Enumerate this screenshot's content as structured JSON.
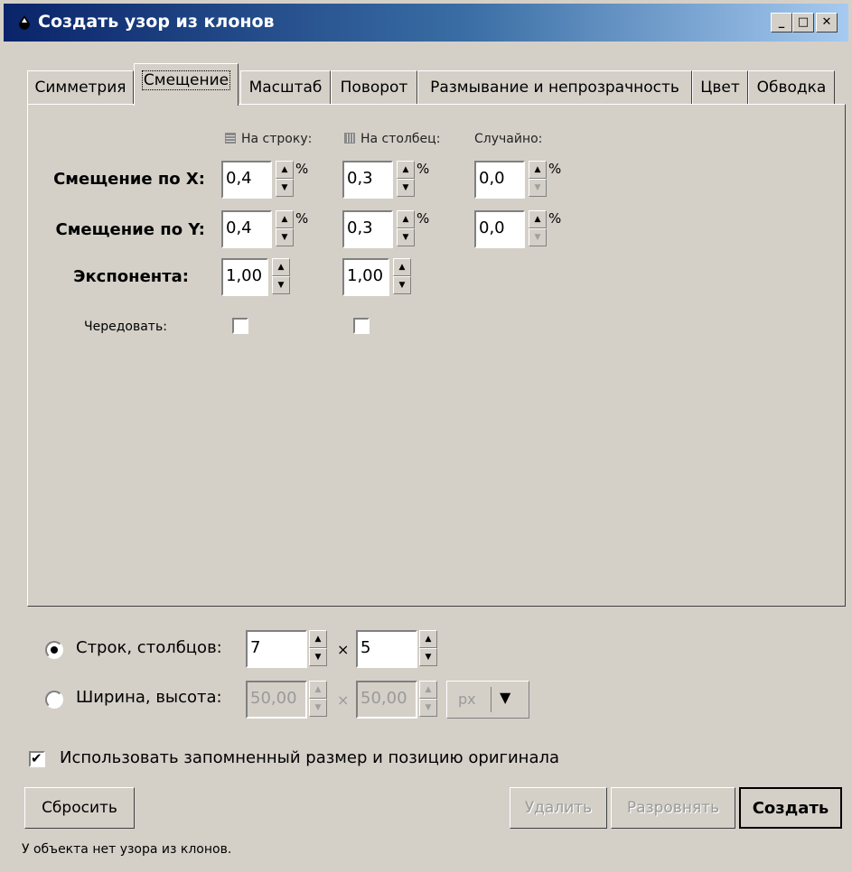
{
  "window": {
    "title": "Создать узор из клонов",
    "controls": {
      "minimize": "_",
      "maximize": "□",
      "close": "✕"
    }
  },
  "tabs": [
    {
      "label": "Симметрия"
    },
    {
      "label": "Смещение",
      "active": true
    },
    {
      "label": "Масштаб"
    },
    {
      "label": "Поворот"
    },
    {
      "label": "Размывание и непрозрачность"
    },
    {
      "label": "Цвет"
    },
    {
      "label": "Обводка"
    }
  ],
  "shift_tab": {
    "columns": {
      "per_row": "На строку:",
      "per_column": "На столбец:",
      "random": "Случайно:"
    },
    "shift_x": {
      "label": "Смещение по X:",
      "per_row": "0,4",
      "per_column": "0,3",
      "random": "0,0",
      "unit": "%"
    },
    "shift_y": {
      "label": "Смещение по Y:",
      "per_row": "0,4",
      "per_column": "0,3",
      "random": "0,0",
      "unit": "%"
    },
    "exponent": {
      "label": "Экспонента:",
      "per_row": "1,00",
      "per_column": "1,00"
    },
    "alternate": {
      "label": "Чередовать:",
      "per_row": false,
      "per_column": false
    }
  },
  "size_mode": {
    "rows_cols": {
      "label": "Строк, столбцов:",
      "rows": "7",
      "cols": "5",
      "selected": true
    },
    "width_height": {
      "label": "Ширина, высота:",
      "width": "50,00",
      "height": "50,00",
      "unit": "px",
      "selected": false
    },
    "times": "×"
  },
  "use_saved": {
    "label": "Использовать запомненный размер и позицию оригинала",
    "checked": true
  },
  "buttons": {
    "reset": "Сбросить",
    "remove": "Удалить",
    "unclump": "Разровнять",
    "create": "Создать"
  },
  "status": "У объекта нет узора из клонов."
}
